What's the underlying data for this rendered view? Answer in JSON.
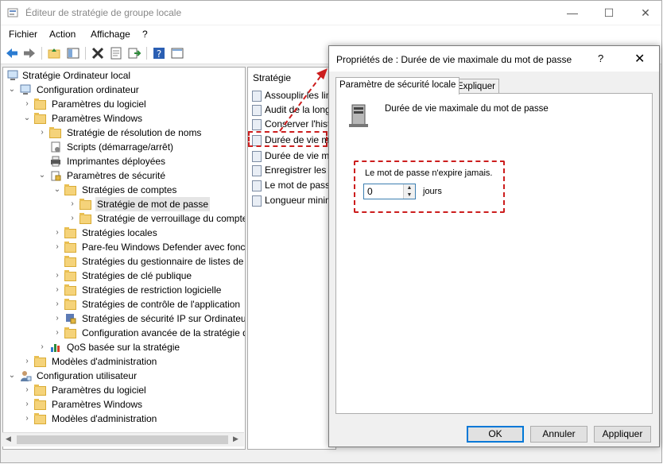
{
  "window": {
    "title": "Éditeur de stratégie de groupe locale",
    "minimize": "—",
    "maximize": "☐",
    "close": "✕"
  },
  "menu": [
    "Fichier",
    "Action",
    "Affichage",
    "?"
  ],
  "tree": {
    "nodes": [
      {
        "label": "Stratégie Ordinateur local",
        "arrow": "",
        "icon": "computer-icon"
      },
      {
        "label": "Configuration ordinateur",
        "arrow": "⌄",
        "icon": "computer-icon"
      },
      {
        "label": "Paramètres du logiciel",
        "arrow": "›",
        "icon": "folder-icon"
      },
      {
        "label": "Paramètres Windows",
        "arrow": "⌄",
        "icon": "folder-icon"
      },
      {
        "label": "Stratégie de résolution de noms",
        "arrow": "›",
        "icon": "folder-icon"
      },
      {
        "label": "Scripts (démarrage/arrêt)",
        "arrow": "",
        "icon": "script-icon"
      },
      {
        "label": "Imprimantes déployées",
        "arrow": "",
        "icon": "printer-icon"
      },
      {
        "label": "Paramètres de sécurité",
        "arrow": "⌄",
        "icon": "security-icon"
      },
      {
        "label": "Stratégies de comptes",
        "arrow": "⌄",
        "icon": "folder-lock-icon"
      },
      {
        "label": "Stratégie de mot de passe",
        "arrow": "›",
        "icon": "folder-lock-icon"
      },
      {
        "label": "Stratégie de verrouillage du compte",
        "arrow": "›",
        "icon": "folder-lock-icon"
      },
      {
        "label": "Stratégies locales",
        "arrow": "›",
        "icon": "folder-lock-icon"
      },
      {
        "label": "Pare-feu Windows Defender avec fonctionnalités avancées",
        "arrow": "›",
        "icon": "folder-icon"
      },
      {
        "label": "Stratégies du gestionnaire de listes de réseaux",
        "arrow": "",
        "icon": "folder-icon"
      },
      {
        "label": "Stratégies de clé publique",
        "arrow": "›",
        "icon": "folder-icon"
      },
      {
        "label": "Stratégies de restriction logicielle",
        "arrow": "›",
        "icon": "folder-icon"
      },
      {
        "label": "Stratégies de contrôle de l'application",
        "arrow": "›",
        "icon": "folder-icon"
      },
      {
        "label": "Stratégies de sécurité IP sur Ordinateur local",
        "arrow": "›",
        "icon": "ipsec-icon"
      },
      {
        "label": "Configuration avancée de la stratégie d'audit",
        "arrow": "›",
        "icon": "folder-icon"
      },
      {
        "label": "QoS basée sur la stratégie",
        "arrow": "›",
        "icon": "chart-icon"
      },
      {
        "label": "Modèles d'administration",
        "arrow": "›",
        "icon": "folder-icon"
      },
      {
        "label": "Configuration utilisateur",
        "arrow": "⌄",
        "icon": "user-icon"
      },
      {
        "label": "Paramètres du logiciel",
        "arrow": "›",
        "icon": "folder-icon"
      },
      {
        "label": "Paramètres Windows",
        "arrow": "›",
        "icon": "folder-icon"
      },
      {
        "label": "Modèles d'administration",
        "arrow": "›",
        "icon": "folder-icon"
      }
    ]
  },
  "policies": {
    "header": "Stratégie",
    "items": [
      "Assouplir les limites",
      "Audit de la longueur",
      "Conserver l'historique",
      "Durée de vie maximale",
      "Durée de vie minimale",
      "Enregistrer les mots",
      "Le mot de passe doit",
      "Longueur minimale"
    ]
  },
  "dialog": {
    "title": "Propriétés de : Durée de vie maximale du mot de passe",
    "help": "?",
    "close": "✕",
    "tabs": [
      "Paramètre de sécurité locale",
      "Expliquer"
    ],
    "policy_name": "Durée de vie maximale du mot de passe",
    "never_expire": "Le mot de passe n'expire jamais.",
    "value": "0",
    "units": "jours",
    "buttons": {
      "ok": "OK",
      "cancel": "Annuler",
      "apply": "Appliquer"
    }
  },
  "colors": {
    "highlight": "#cc1d1d",
    "accent": "#0078d7"
  }
}
